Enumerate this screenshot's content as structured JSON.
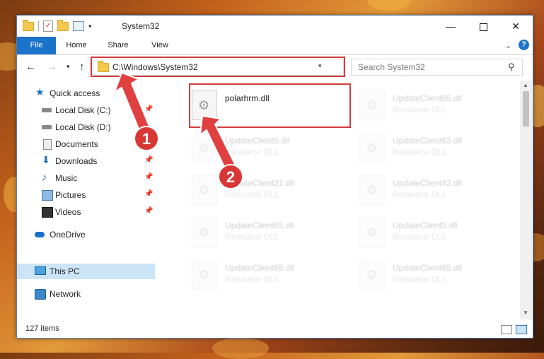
{
  "window": {
    "title": "System32",
    "minimize_glyph": "—",
    "close_glyph": "✕"
  },
  "ribbon": {
    "tabs": [
      "File",
      "Home",
      "Share",
      "View"
    ],
    "help_glyph": "?"
  },
  "address": {
    "path": "C:\\Windows\\System32",
    "search_placeholder": "Search System32"
  },
  "nav": {
    "items": [
      {
        "label": "Quick access",
        "icon": "star-icon"
      },
      {
        "label": "Local Disk (C:)",
        "icon": "disk-icon",
        "pinned": true
      },
      {
        "label": "Local Disk (D:)",
        "icon": "disk-icon"
      },
      {
        "label": "Documents",
        "icon": "documents-icon",
        "pinned": true
      },
      {
        "label": "Downloads",
        "icon": "download-icon",
        "pinned": true
      },
      {
        "label": "Music",
        "icon": "music-icon",
        "pinned": true
      },
      {
        "label": "Pictures",
        "icon": "pictures-icon",
        "pinned": true
      },
      {
        "label": "Videos",
        "icon": "videos-icon",
        "pinned": true
      },
      {
        "label": "OneDrive",
        "icon": "cloud-icon"
      },
      {
        "label": "This PC",
        "icon": "pc-icon",
        "selected": true
      },
      {
        "label": "Network",
        "icon": "network-icon"
      }
    ]
  },
  "files": [
    {
      "name": "polarhrm.dll",
      "type": ""
    },
    {
      "name": "UpdateClient65.dll",
      "type": "Resource DLL"
    },
    {
      "name": "UpdateClient5.dll",
      "type": "Resource DLL"
    },
    {
      "name": "UpdateClient63.dll",
      "type": "Resource DLL"
    },
    {
      "name": "UpdateClient21.dll",
      "type": "Resource DLL"
    },
    {
      "name": "UpdateClient42.dll",
      "type": "Resource DLL"
    },
    {
      "name": "UpdateClient65.dll",
      "type": "Resource DLL"
    },
    {
      "name": "UpdateClient5.dll",
      "type": "Resource DLL"
    },
    {
      "name": "UpdateClient65.dll",
      "type": "Resource DLL"
    },
    {
      "name": "UpdateClient65.dll",
      "type": "Resource DLL"
    }
  ],
  "status": {
    "item_count": "127 items"
  },
  "annotations": {
    "badge1": "1",
    "badge2": "2"
  },
  "colors": {
    "accent": "#1a73c8",
    "highlight_box": "#d23b3b",
    "badge": "#d93636",
    "selection": "#cce4f7"
  }
}
